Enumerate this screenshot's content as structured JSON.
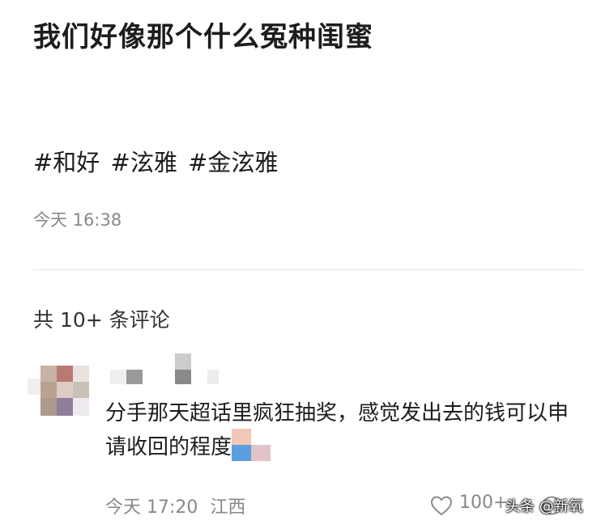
{
  "post": {
    "title": "我们好像那个什么冤种闺蜜",
    "hashtags": [
      "#和好",
      "#泫雅",
      "#金泫雅"
    ],
    "time": "今天 16:38"
  },
  "comments_section": {
    "header": "共 10+ 条评论"
  },
  "comment": {
    "text": "分手那天超话里疯狂抽奖，感觉发出去的钱可以申请收回的程度",
    "time": "今天 17:20",
    "location": "江西",
    "like_count": "100+"
  },
  "watermark": {
    "text": "头条 @新氧"
  },
  "colors": {
    "primary_text": "#1d1d1d",
    "secondary_text": "#888888",
    "divider": "#e5e5e5"
  }
}
